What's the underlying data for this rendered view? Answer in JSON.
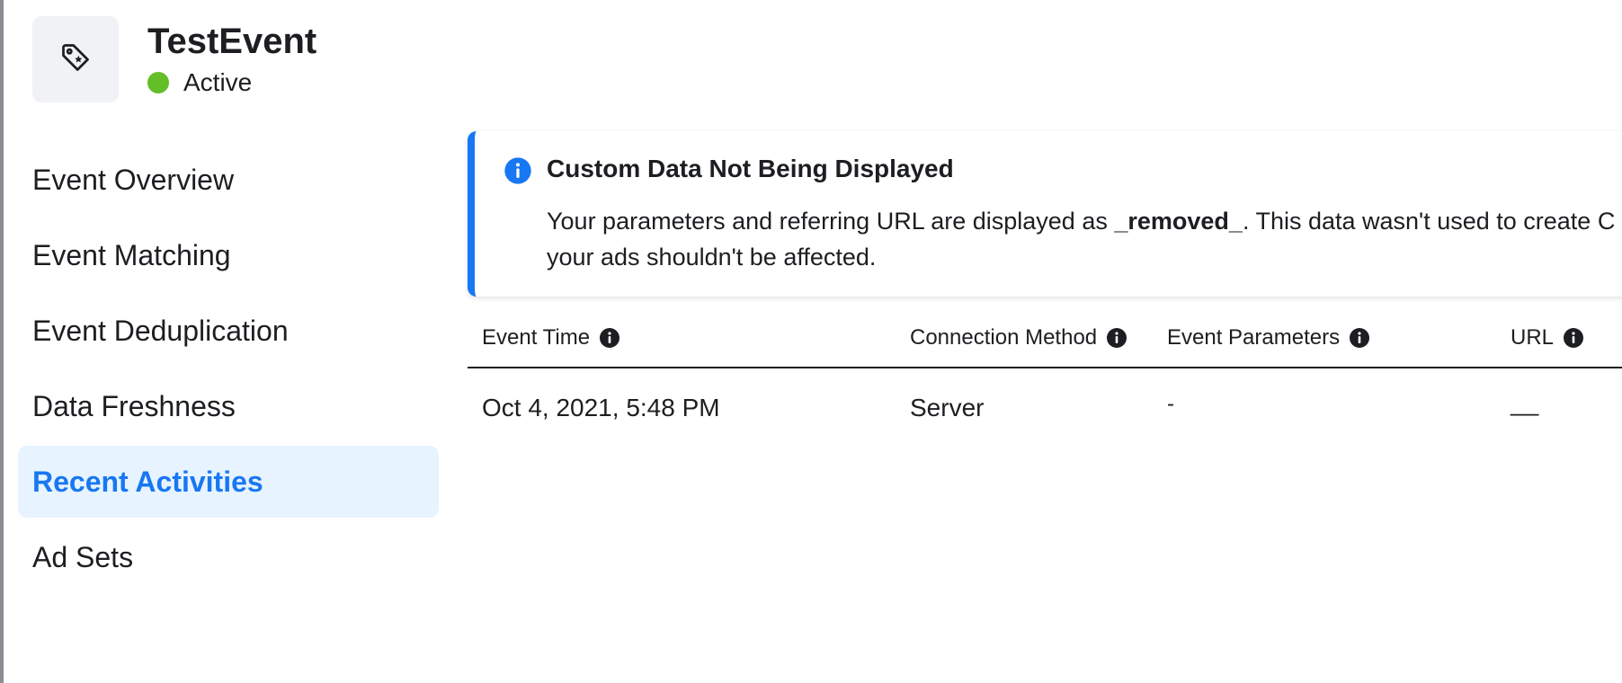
{
  "event": {
    "name": "TestEvent",
    "status": "Active",
    "icon": "tag-icon",
    "status_color": "#63be27"
  },
  "sidebar": {
    "items": [
      {
        "label": "Event Overview",
        "active": false
      },
      {
        "label": "Event Matching",
        "active": false
      },
      {
        "label": "Event Deduplication",
        "active": false
      },
      {
        "label": "Data Freshness",
        "active": false
      },
      {
        "label": "Recent Activities",
        "active": true
      },
      {
        "label": "Ad Sets",
        "active": false
      }
    ]
  },
  "banner": {
    "title": "Custom Data Not Being Displayed",
    "body_before": "Your parameters and referring URL are displayed as ",
    "body_bold": "_removed_",
    "body_after": ". This data wasn't used to create C",
    "body_line2": "your ads shouldn't be affected.",
    "icon": "info-icon",
    "accent_color": "#1877f2"
  },
  "table": {
    "columns": [
      {
        "label": "Event Time"
      },
      {
        "label": "Connection Method"
      },
      {
        "label": "Event Parameters"
      },
      {
        "label": "URL"
      }
    ],
    "rows": [
      {
        "event_time": "Oct 4, 2021, 5:48 PM",
        "connection_method": "Server",
        "event_parameters": "-",
        "url": "__"
      }
    ]
  },
  "colors": {
    "accent": "#1877f2",
    "active_bg": "#e7f3ff"
  }
}
